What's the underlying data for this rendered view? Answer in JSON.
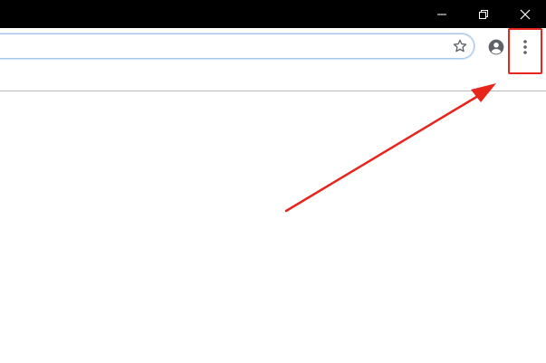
{
  "window_controls": {
    "minimize_icon": "minimize-icon",
    "restore_icon": "restore-icon",
    "close_icon": "close-icon"
  },
  "toolbar": {
    "address_value": "",
    "bookmark_icon": "star-icon",
    "profile_icon": "account-circle-icon",
    "menu_icon": "vertical-dots-icon"
  },
  "annotation": {
    "color": "#e8251c",
    "highlight_target": "menu-button"
  },
  "colors": {
    "titlebar": "#000000",
    "omnibox_border": "#a9c7ea",
    "icon": "#5f6368"
  }
}
